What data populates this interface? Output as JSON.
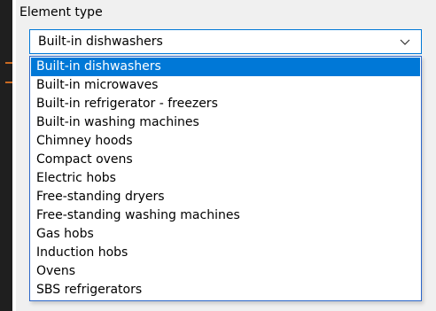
{
  "field": {
    "label": "Element type",
    "selected_value": "Built-in dishwashers"
  },
  "dropdown": {
    "options": [
      "Built-in dishwashers",
      "Built-in microwaves",
      "Built-in refrigerator - freezers",
      "Built-in washing machines",
      "Chimney hoods",
      "Compact ovens",
      "Electric hobs",
      "Free-standing dryers",
      "Free-standing washing machines",
      "Gas hobs",
      "Induction hobs",
      "Ovens",
      "SBS refrigerators"
    ],
    "highlighted_index": 0
  },
  "colors": {
    "accent": "#0078d7",
    "dropdown_border": "#2b66c9",
    "panel_background": "#f0f0f0"
  },
  "icons": {
    "dropdown_arrow": "chevron-down-icon"
  }
}
